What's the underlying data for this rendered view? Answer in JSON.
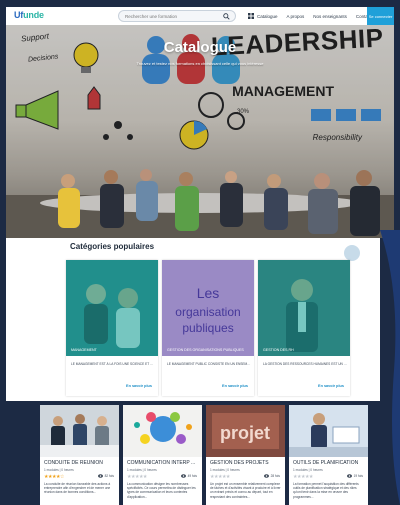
{
  "header": {
    "logo_text": "Ufunde",
    "search_placeholder": "Rechercher une formation",
    "nav": [
      "Catalogue",
      "A propos",
      "Nos enseignants",
      "Contact"
    ],
    "login_label": "Se connecter"
  },
  "hero": {
    "title": "Catalogue",
    "subtitle": "Trouvez et testez nos formations en choisissant celle qui vous intéresse"
  },
  "popular": {
    "title": "Catégories populaires",
    "items": [
      {
        "label": "MANAGEMENT",
        "desc": "LE MANAGEMENT EST À LA FOIS UNE SCIENCE ET UN A...",
        "more": "En savoir plus"
      },
      {
        "label": "GESTION DES ORGANISATIONS PUBLIQUES",
        "desc": "LE MANAGEMENT PUBLIC CONSISTE EN UN ENSEMBLE ...",
        "more": "En savoir plus",
        "image_text": "Les organisation publiques"
      },
      {
        "label": "GESTION DES RH",
        "desc": "LA GESTION DES RESSOURCES HUMAINES EST UN ENS...",
        "more": "En savoir plus"
      }
    ]
  },
  "courses": [
    {
      "title": "CONDUITE DE REUNION",
      "meta": "1 modules | 0 heures",
      "stars": 4,
      "views": "82 fois",
      "desc": "La conduite de réunion favorable des actions à entreprendre afin d'engendrer et de mener une réunion dans de bonnes conditions..."
    },
    {
      "title": "COMMUNICATION INTERP ...",
      "meta": "1 modules | 0 heures",
      "stars": 0,
      "views": "49 fois",
      "desc": "La communication désigne les nombreuses spécificités. Ce cours permettra de distinguer les types de communication et leurs contextes d'application..."
    },
    {
      "title": "GESTION DES PROJETS",
      "meta": "1 modules | 0 heures",
      "stars": 0,
      "views": "28 fois",
      "desc": "Un projet est un ensemble relativement complexe de tâches et d'activités visant à produire et à livrer un extrant précis et connu au départ, tout en respectant des contraintes...",
      "image_text": "projet"
    },
    {
      "title": "OUTILS DE PLANIFICATION",
      "meta": "1 modules | 0 heures",
      "stars": 0,
      "views": "19 fois",
      "desc": "La formation permet l'acquisition des différents outils de planification stratégique et des rôles qu'ont tenir dans la mise en œuvre des programmes..."
    }
  ],
  "colors": {
    "accent": "#1fa0d9",
    "teal_overlay": "#1aa99b",
    "purple_overlay": "#5b3fa6",
    "star": "#f0a21b",
    "background": "#1c2a44"
  }
}
